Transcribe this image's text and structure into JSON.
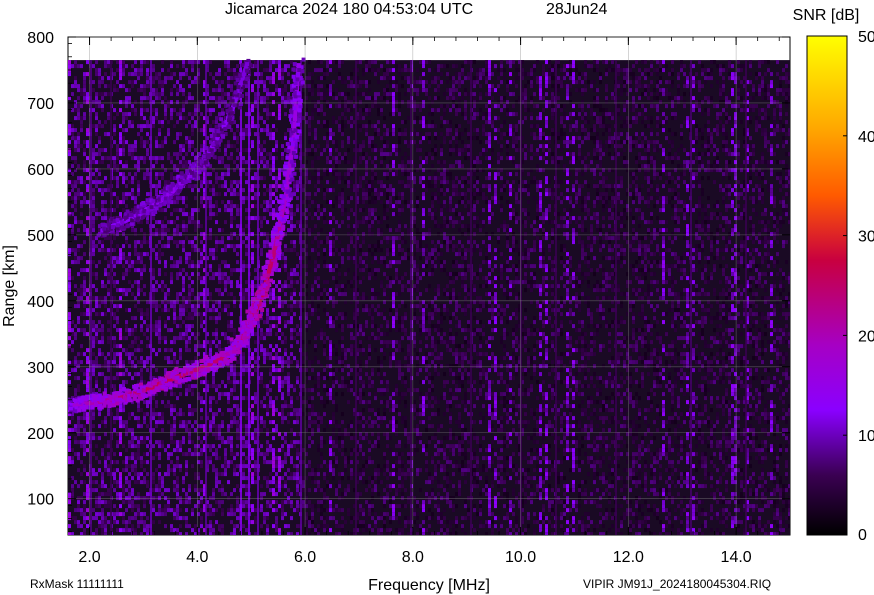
{
  "header": {
    "title": "Jicamarca 2024 180 04:53:04 UTC",
    "date": "28Jun24"
  },
  "footer": {
    "rxmask": "RxMask 11111111",
    "filename": "VIPIR  JM91J_2024180045304.RIQ"
  },
  "chart_data": {
    "type": "heatmap",
    "title": "Jicamarca 2024 180 04:53:04 UTC",
    "xlabel": "Frequency [MHz]",
    "ylabel": "Range [km]",
    "xlim": [
      1.6,
      15.0
    ],
    "ylim": [
      45,
      800
    ],
    "data_range_max": 765,
    "xticks": [
      2.0,
      4.0,
      6.0,
      8.0,
      10.0,
      12.0,
      14.0
    ],
    "xtick_labels": [
      "2.0",
      "4.0",
      "6.0",
      "8.0",
      "10.0",
      "12.0",
      "14.0"
    ],
    "yticks": [
      100,
      200,
      300,
      400,
      500,
      600,
      700,
      800
    ],
    "ytick_labels": [
      "100",
      "200",
      "300",
      "400",
      "500",
      "600",
      "700",
      "800"
    ],
    "grid": true,
    "colorbar": {
      "label": "SNR [dB]",
      "min": 0,
      "max": 50,
      "ticks": [
        0,
        10,
        20,
        30,
        40,
        50
      ],
      "tick_labels": [
        "0",
        "10",
        "20",
        "30",
        "40",
        "50"
      ],
      "colormap": [
        "#000000",
        "#3a0052",
        "#8a00ff",
        "#a600c4",
        "#c80040",
        "#ff5a00",
        "#ffaa00",
        "#ffff00"
      ]
    },
    "traces": [
      {
        "name": "",
        "points": [
          {
            "f": 1.6,
            "h": 245,
            "snr": 16
          },
          {
            "f": 2.0,
            "h": 248,
            "snr": 20
          },
          {
            "f": 2.5,
            "h": 255,
            "snr": 24
          },
          {
            "f": 3.0,
            "h": 268,
            "snr": 26
          },
          {
            "f": 3.5,
            "h": 285,
            "snr": 26
          },
          {
            "f": 4.0,
            "h": 300,
            "snr": 24
          },
          {
            "f": 4.5,
            "h": 318,
            "snr": 25
          },
          {
            "f": 4.8,
            "h": 345,
            "snr": 24
          },
          {
            "f": 5.0,
            "h": 380,
            "snr": 26
          },
          {
            "f": 5.2,
            "h": 420,
            "snr": 28
          },
          {
            "f": 5.4,
            "h": 480,
            "snr": 24
          },
          {
            "f": 5.6,
            "h": 560,
            "snr": 18
          },
          {
            "f": 5.75,
            "h": 650,
            "snr": 16
          },
          {
            "f": 5.85,
            "h": 765,
            "snr": 15
          }
        ]
      },
      {
        "name": "",
        "points": [
          {
            "f": 2.2,
            "h": 510,
            "snr": 12
          },
          {
            "f": 2.8,
            "h": 530,
            "snr": 13
          },
          {
            "f": 3.3,
            "h": 555,
            "snr": 14
          },
          {
            "f": 3.8,
            "h": 590,
            "snr": 14
          },
          {
            "f": 4.2,
            "h": 630,
            "snr": 13
          },
          {
            "f": 4.6,
            "h": 690,
            "snr": 12
          },
          {
            "f": 4.9,
            "h": 765,
            "snr": 11
          }
        ]
      }
    ]
  }
}
